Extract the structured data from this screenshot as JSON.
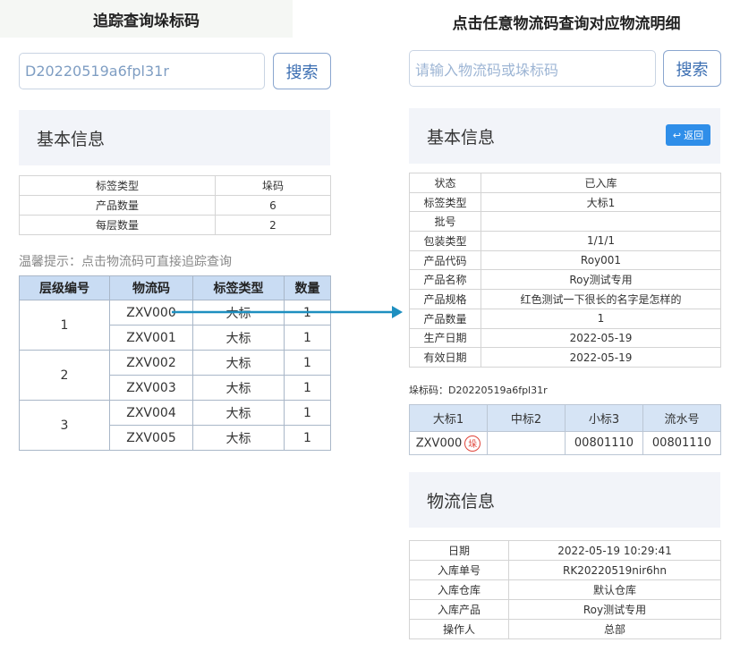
{
  "left": {
    "title": "追踪查询垛标码",
    "search": {
      "value": "D20220519a6fpl31r",
      "button": "搜索"
    },
    "basic_info": {
      "heading": "基本信息",
      "rows": [
        {
          "label": "标签类型",
          "value": "垛码"
        },
        {
          "label": "产品数量",
          "value": "6"
        },
        {
          "label": "每层数量",
          "value": "2"
        }
      ]
    },
    "tip": "温馨提示：点击物流码可直接追踪查询",
    "level_table": {
      "headers": [
        "层级编号",
        "物流码",
        "标签类型",
        "数量"
      ],
      "groups": [
        {
          "level": "1",
          "rows": [
            {
              "code": "ZXV000",
              "type": "大标",
              "qty": "1"
            },
            {
              "code": "ZXV001",
              "type": "大标",
              "qty": "1"
            }
          ]
        },
        {
          "level": "2",
          "rows": [
            {
              "code": "ZXV002",
              "type": "大标",
              "qty": "1"
            },
            {
              "code": "ZXV003",
              "type": "大标",
              "qty": "1"
            }
          ]
        },
        {
          "level": "3",
          "rows": [
            {
              "code": "ZXV004",
              "type": "大标",
              "qty": "1"
            },
            {
              "code": "ZXV005",
              "type": "大标",
              "qty": "1"
            }
          ]
        }
      ]
    }
  },
  "right": {
    "title": "点击任意物流码查询对应物流明细",
    "search": {
      "placeholder": "请输入物流码或垛标码",
      "button": "搜索"
    },
    "basic_info": {
      "heading": "基本信息",
      "back_button": "返回",
      "rows": [
        {
          "label": "状态",
          "value": "已入库"
        },
        {
          "label": "标签类型",
          "value": "大标1"
        },
        {
          "label": "批号",
          "value": ""
        },
        {
          "label": "包装类型",
          "value": "1/1/1"
        },
        {
          "label": "产品代码",
          "value": "Roy001"
        },
        {
          "label": "产品名称",
          "value": "Roy测试专用"
        },
        {
          "label": "产品规格",
          "value": "红色测试一下很长的名字是怎样的"
        },
        {
          "label": "产品数量",
          "value": "1"
        },
        {
          "label": "生产日期",
          "value": "2022-05-19"
        },
        {
          "label": "有效日期",
          "value": "2022-05-19"
        }
      ]
    },
    "barcode": "垛标码：D20220519a6fpl31r",
    "code_table": {
      "headers": [
        "大标1",
        "中标2",
        "小标3",
        "流水号"
      ],
      "row": {
        "big": "ZXV000",
        "stamp": "垛",
        "mid": "",
        "small": "00801110",
        "serial": "00801110"
      }
    },
    "logistics": {
      "heading": "物流信息",
      "rows": [
        {
          "label": "日期",
          "value": "2022-05-19 10:29:41"
        },
        {
          "label": "入库单号",
          "value": "RK20220519nir6hn"
        },
        {
          "label": "入库仓库",
          "value": "默认仓库"
        },
        {
          "label": "入库产品",
          "value": "Roy测试专用"
        },
        {
          "label": "操作人",
          "value": "总部"
        }
      ]
    }
  },
  "colors": {
    "arrow": "#1e8fc0",
    "accent": "#2f8ee9",
    "header_bg": "#c9dcf3",
    "stamp": "#e0443a"
  }
}
